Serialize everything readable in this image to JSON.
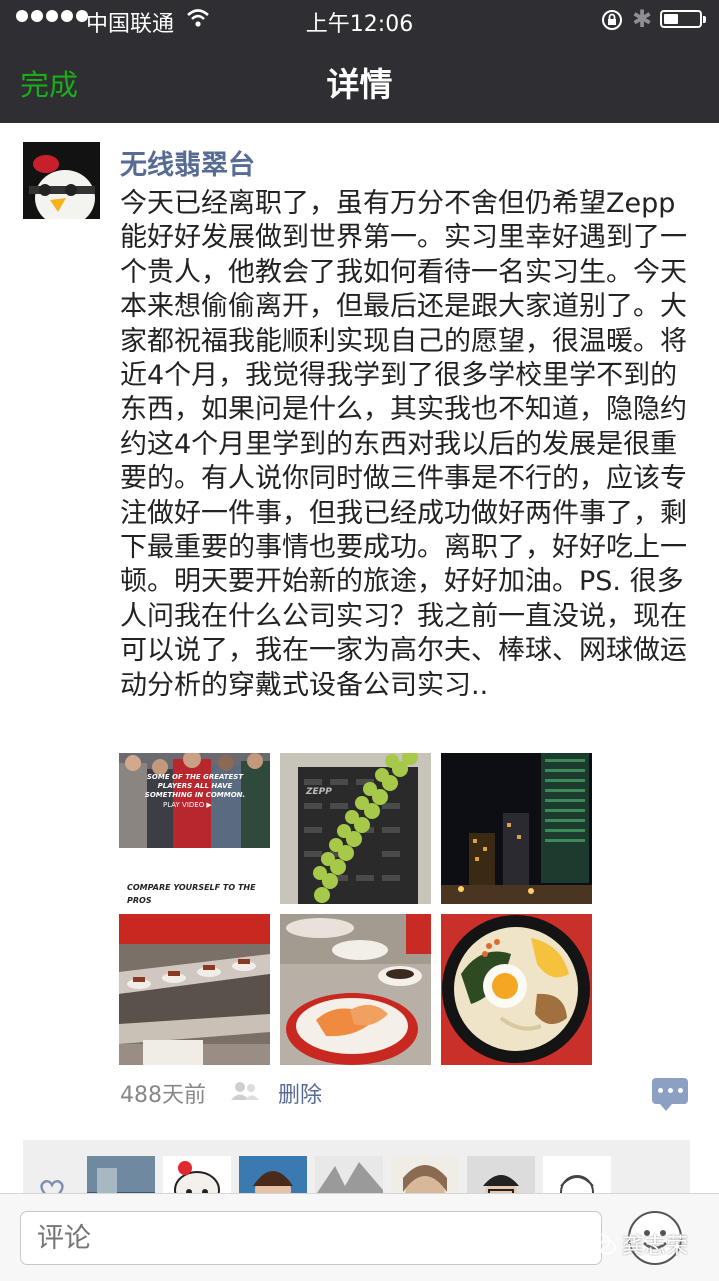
{
  "status_bar": {
    "carrier": "中国联通",
    "time": "上午12:06"
  },
  "nav": {
    "back_label": "完成",
    "title": "详情"
  },
  "post": {
    "author": "无线翡翠台",
    "text": "今天已经离职了，虽有万分不舍但仍希望Zepp能好好发展做到世界第一。实习里幸好遇到了一个贵人，他教会了我如何看待一名实习生。今天本来想偷偷离开，但最后还是跟大家道别了。大家都祝福我能顺利实现自己的愿望，很温暖。将近4个月，我觉得我学到了很多学校里学不到的东西，如果问是什么，其实我也不知道，隐隐约约这4个月里学到的东西对我以后的发展是很重要的。有人说你同时做三件事是不行的，应该专注做好一件事，但我已经成功做好两件事了，剩下最重要的事情也要成功。离职了，好好吃上一顿。明天要开始新的旅途，好好加油。PS. 很多人问我在什么公司实习？我之前一直没说，现在可以说了，我在一家为高尔夫、棒球、网球做运动分析的穿戴式设备公司实习..",
    "photos": [
      {
        "name": "zepp-ad-photo",
        "caption_top": "SOME OF THE GREATEST PLAYERS ALL HAVE SOMETHING IN COMMON.",
        "caption_play": "PLAY VIDEO ▶",
        "caption_bottom": "COMPARE YOURSELF TO THE PROS"
      },
      {
        "name": "zepp-balloon-photo",
        "logo_text": "ZEPP"
      },
      {
        "name": "night-city-photo"
      },
      {
        "name": "sushi-conveyor-photo"
      },
      {
        "name": "sushi-plate-photo"
      },
      {
        "name": "ramen-bowl-photo"
      }
    ],
    "time_ago": "488天前",
    "delete_label": "删除"
  },
  "comment_bar": {
    "placeholder": "评论"
  },
  "watermark": "龚志荣",
  "colors": {
    "accent_green": "#1aad19",
    "link_blue": "#576b95",
    "topbar": "#2e2e33"
  }
}
